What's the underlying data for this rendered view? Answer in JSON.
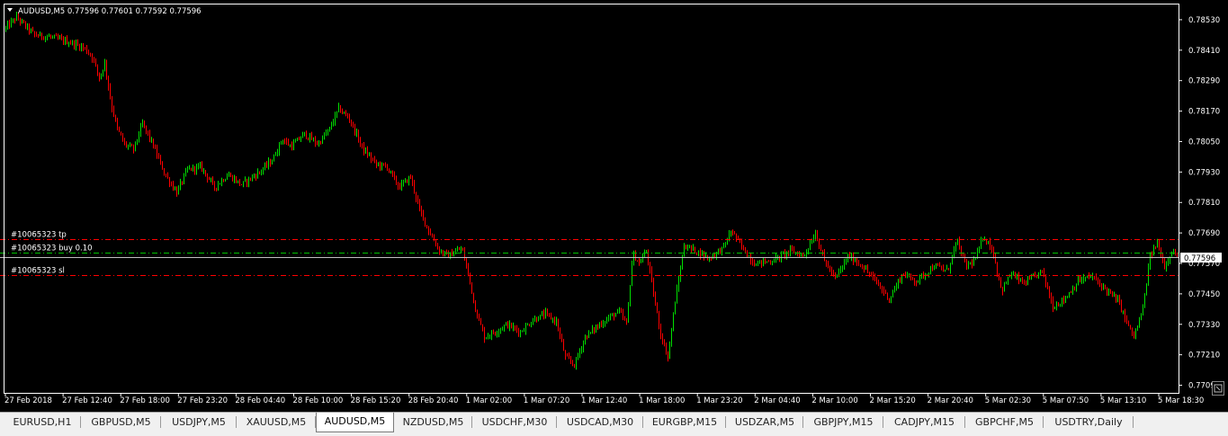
{
  "header": {
    "symbol_line": "AUDUSD,M5  0.77596 0.77601 0.77592 0.77596"
  },
  "price_axis": {
    "labels": [
      "0.78530",
      "0.78410",
      "0.78290",
      "0.78170",
      "0.78050",
      "0.77930",
      "0.77810",
      "0.77690",
      "0.77570",
      "0.77450",
      "0.77330",
      "0.77210",
      "0.77090"
    ],
    "current_price": "0.77596"
  },
  "time_axis": {
    "labels": [
      "27 Feb 2018",
      "27 Feb 12:40",
      "27 Feb 18:00",
      "27 Feb 23:20",
      "28 Feb 04:40",
      "28 Feb 10:00",
      "28 Feb 15:20",
      "28 Feb 20:40",
      "1 Mar 02:00",
      "1 Mar 07:20",
      "1 Mar 12:40",
      "1 Mar 18:00",
      "1 Mar 23:20",
      "2 Mar 04:40",
      "2 Mar 10:00",
      "2 Mar 15:20",
      "2 Mar 20:40",
      "5 Mar 02:30",
      "5 Mar 07:50",
      "5 Mar 13:10",
      "5 Mar 18:30"
    ]
  },
  "orders": {
    "tp_label": "#10065323 tp",
    "buy_label": "#10065323 buy 0.10",
    "sl_label": "#10065323 sl",
    "tp_price": 0.77665,
    "buy_price": 0.77611,
    "sl_price": 0.77525
  },
  "colors": {
    "background": "#000000",
    "bull": "#00e000",
    "bear": "#ff0000",
    "text": "#ffffff",
    "order_line": "#ff0000",
    "buy_line": "#00c000"
  },
  "chart_data": {
    "type": "candlestick",
    "symbol": "AUDUSD",
    "timeframe": "M5",
    "ylim": [
      0.7706,
      0.7859
    ],
    "bid": 0.77596,
    "path_anchors": [
      [
        0,
        0.7847
      ],
      [
        20,
        0.7854
      ],
      [
        40,
        0.7847
      ],
      [
        60,
        0.7846
      ],
      [
        80,
        0.7844
      ],
      [
        95,
        0.7842
      ],
      [
        105,
        0.7838
      ],
      [
        112,
        0.783
      ],
      [
        118,
        0.7836
      ],
      [
        125,
        0.782
      ],
      [
        132,
        0.781
      ],
      [
        140,
        0.7804
      ],
      [
        150,
        0.7802
      ],
      [
        160,
        0.7812
      ],
      [
        170,
        0.7805
      ],
      [
        185,
        0.7792
      ],
      [
        198,
        0.7785
      ],
      [
        210,
        0.7794
      ],
      [
        225,
        0.7795
      ],
      [
        240,
        0.7787
      ],
      [
        255,
        0.7792
      ],
      [
        270,
        0.7788
      ],
      [
        290,
        0.7793
      ],
      [
        305,
        0.7798
      ],
      [
        315,
        0.7806
      ],
      [
        325,
        0.7803
      ],
      [
        340,
        0.7808
      ],
      [
        355,
        0.7804
      ],
      [
        368,
        0.781
      ],
      [
        378,
        0.7818
      ],
      [
        390,
        0.7814
      ],
      [
        405,
        0.7802
      ],
      [
        420,
        0.7796
      ],
      [
        432,
        0.7795
      ],
      [
        445,
        0.7787
      ],
      [
        458,
        0.7791
      ],
      [
        468,
        0.7778
      ],
      [
        478,
        0.777
      ],
      [
        490,
        0.7762
      ],
      [
        500,
        0.776
      ],
      [
        515,
        0.7763
      ],
      [
        522,
        0.7753
      ],
      [
        530,
        0.7739
      ],
      [
        540,
        0.7728
      ],
      [
        552,
        0.773
      ],
      [
        565,
        0.7733
      ],
      [
        580,
        0.773
      ],
      [
        595,
        0.7735
      ],
      [
        608,
        0.7737
      ],
      [
        620,
        0.7734
      ],
      [
        630,
        0.772
      ],
      [
        640,
        0.7717
      ],
      [
        652,
        0.7728
      ],
      [
        665,
        0.7732
      ],
      [
        680,
        0.7736
      ],
      [
        690,
        0.7738
      ],
      [
        698,
        0.7733
      ],
      [
        705,
        0.7761
      ],
      [
        712,
        0.7757
      ],
      [
        720,
        0.7762
      ],
      [
        728,
        0.7745
      ],
      [
        736,
        0.7729
      ],
      [
        744,
        0.772
      ],
      [
        752,
        0.7742
      ],
      [
        762,
        0.7764
      ],
      [
        775,
        0.7762
      ],
      [
        790,
        0.7759
      ],
      [
        805,
        0.7763
      ],
      [
        815,
        0.777
      ],
      [
        825,
        0.7764
      ],
      [
        840,
        0.7757
      ],
      [
        860,
        0.7758
      ],
      [
        880,
        0.7762
      ],
      [
        895,
        0.776
      ],
      [
        908,
        0.7769
      ],
      [
        918,
        0.7758
      ],
      [
        930,
        0.7751
      ],
      [
        945,
        0.776
      ],
      [
        960,
        0.7756
      ],
      [
        975,
        0.775
      ],
      [
        990,
        0.7743
      ],
      [
        1005,
        0.7753
      ],
      [
        1020,
        0.775
      ],
      [
        1040,
        0.7756
      ],
      [
        1055,
        0.7754
      ],
      [
        1065,
        0.7766
      ],
      [
        1075,
        0.7756
      ],
      [
        1085,
        0.7758
      ],
      [
        1095,
        0.7768
      ],
      [
        1105,
        0.7762
      ],
      [
        1115,
        0.7746
      ],
      [
        1125,
        0.7753
      ],
      [
        1140,
        0.7749
      ],
      [
        1160,
        0.7754
      ],
      [
        1172,
        0.774
      ],
      [
        1185,
        0.7743
      ],
      [
        1200,
        0.775
      ],
      [
        1215,
        0.7752
      ],
      [
        1230,
        0.7747
      ],
      [
        1245,
        0.7742
      ],
      [
        1255,
        0.7733
      ],
      [
        1262,
        0.7728
      ],
      [
        1272,
        0.7739
      ],
      [
        1280,
        0.776
      ],
      [
        1288,
        0.7765
      ],
      [
        1296,
        0.7756
      ],
      [
        1304,
        0.7762
      ],
      [
        1310,
        0.776
      ]
    ]
  }
}
